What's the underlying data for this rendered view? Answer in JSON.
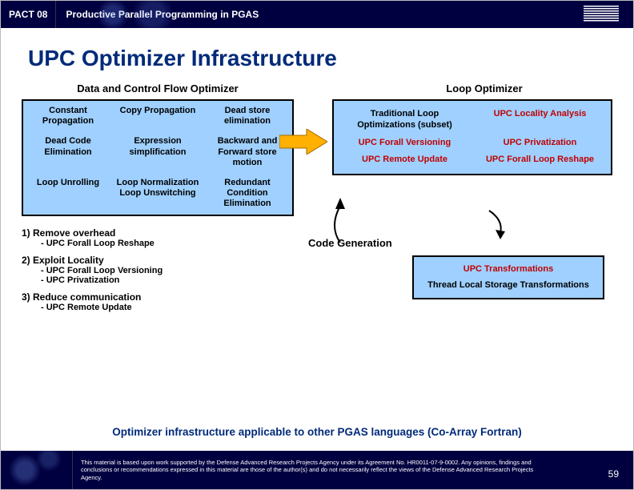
{
  "header": {
    "tag": "PACT 08",
    "title": "Productive Parallel Programming in PGAS"
  },
  "title": "UPC Optimizer Infrastructure",
  "dataflow": {
    "heading": "Data and Control Flow Optimizer",
    "cells": [
      "Constant Propagation",
      "Copy Propagation",
      "Dead store elimination",
      "Dead Code Elimination",
      "Expression simplification",
      "Backward and Forward store motion",
      "Loop Unrolling",
      "Loop Normalization Loop Unswitching",
      "Redundant Condition Elimination"
    ]
  },
  "loop": {
    "heading": "Loop Optimizer",
    "cells_plain": [
      "Traditional Loop Optimizations (subset)"
    ],
    "cells_red": [
      "UPC Locality Analysis",
      "UPC Forall Versioning",
      "UPC Privatization",
      "UPC Remote Update",
      "UPC Forall Loop Reshape"
    ]
  },
  "steps": {
    "s1": "1) Remove overhead",
    "s1a": "- UPC Forall Loop Reshape",
    "s2": "2) Exploit Locality",
    "s2a": "- UPC Forall Loop Versioning",
    "s2b": "- UPC Privatization",
    "s3": "3) Reduce communication",
    "s3a": "- UPC Remote Update"
  },
  "codegen": {
    "label": "Code Generation",
    "line1": "UPC Transformations",
    "line2": "Thread Local Storage Transformations"
  },
  "bottom_note": "Optimizer infrastructure applicable to other PGAS languages (Co-Array Fortran)",
  "footer": {
    "text": "This material is based upon work supported by the Defense Advanced Research Projects Agency under its Agreement No. HR0011-07-9-0002. Any opinions, findings and conclusions or recommendations expressed in this material are those of the author(s) and do not necessarily reflect the views of the Defense Advanced Research Projects Agency.",
    "page": "59"
  }
}
